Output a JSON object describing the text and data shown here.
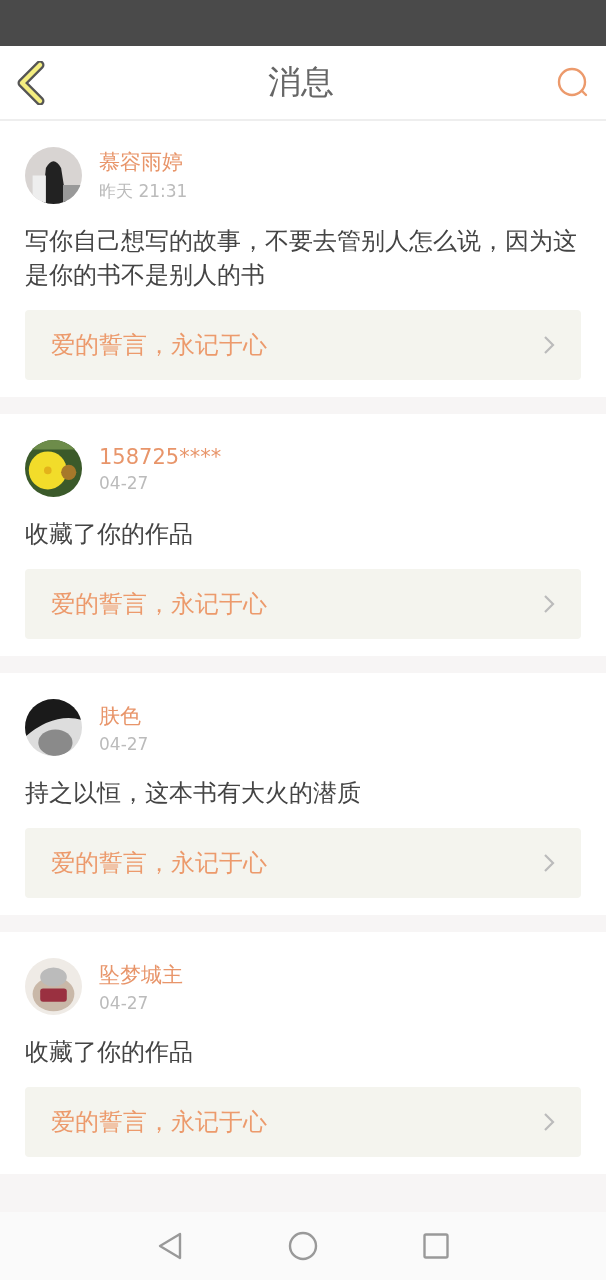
{
  "header": {
    "title": "消息"
  },
  "messages": [
    {
      "name": "慕容雨婷",
      "time": "昨天 21:31",
      "text": "写你自己想写的故事，不要去管别人怎么说，因为这是你的书不是别人的书",
      "book": "爱的誓言，永记于心"
    },
    {
      "name": "158725****",
      "time": "04-27",
      "text": "收藏了你的作品",
      "book": "爱的誓言，永记于心"
    },
    {
      "name": "肤色",
      "time": "04-27",
      "text": "持之以恒，这本书有大火的潜质",
      "book": "爱的誓言，永记于心"
    },
    {
      "name": "坠梦城主",
      "time": "04-27",
      "text": "收藏了你的作品",
      "book": "爱的誓言，永记于心"
    }
  ]
}
